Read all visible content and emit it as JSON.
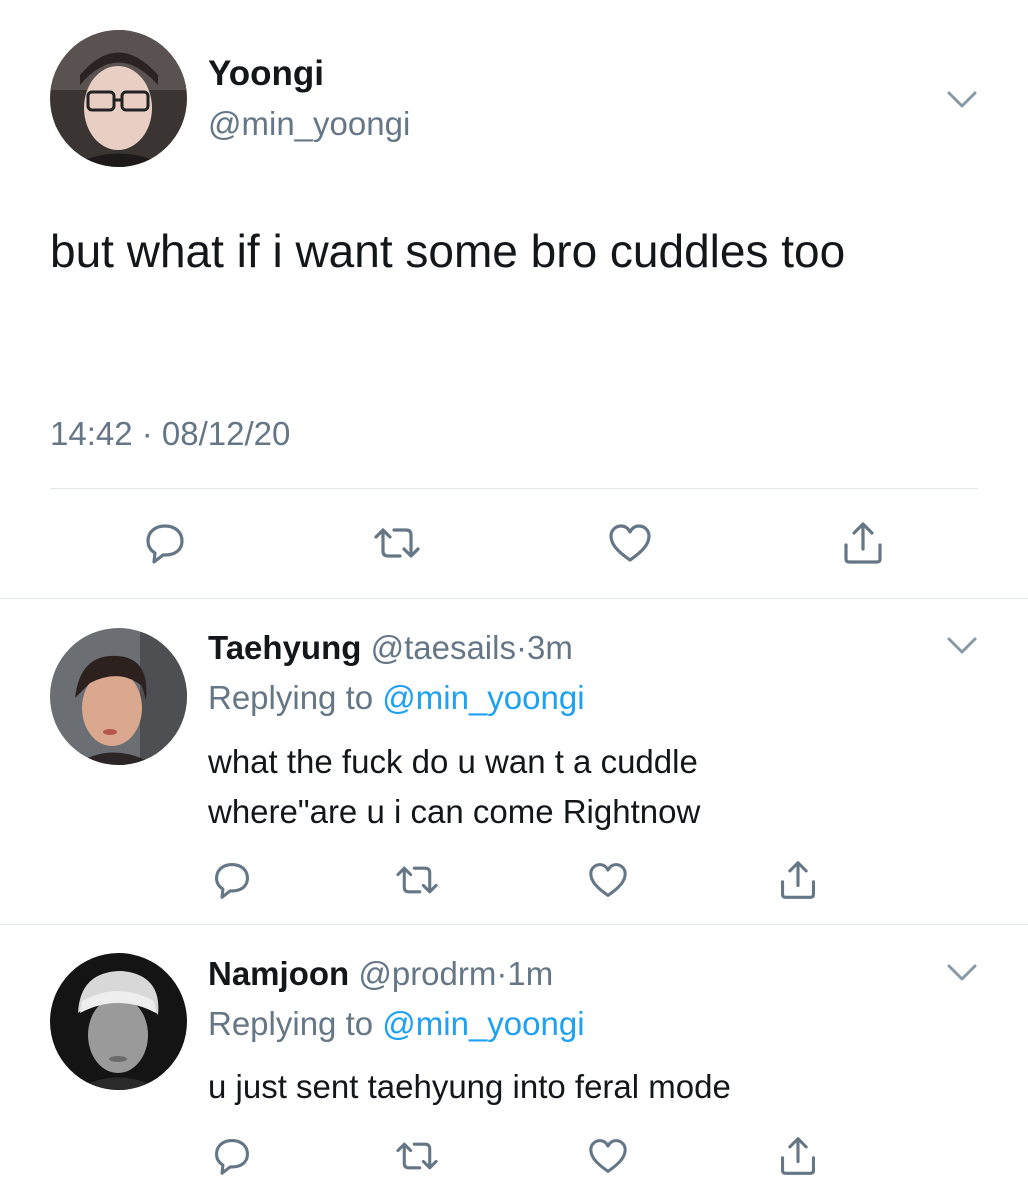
{
  "main_tweet": {
    "name": "Yoongi",
    "handle": "@min_yoongi",
    "text": "but what if i want some bro cuddles too",
    "timestamp": "14:42 · 08/12/20"
  },
  "replies": [
    {
      "name": "Taehyung",
      "handle": "@taesails",
      "separator": "·",
      "time": "3m",
      "replying_prefix": "Replying to",
      "replying_to": "@min_yoongi",
      "text_line1": "what the fuck do u wan t a cuddle",
      "text_line2": "where\"are u i can come Rightnow"
    },
    {
      "name": "Namjoon",
      "handle": "@prodrm",
      "separator": "·",
      "time": "1m",
      "replying_prefix": "Replying to",
      "replying_to": "@min_yoongi",
      "text_line1": "u just sent taehyung into feral mode"
    }
  ],
  "icons": {
    "reply": "reply-icon",
    "retweet": "retweet-icon",
    "like": "heart-icon",
    "share": "share-icon",
    "more": "chevron-down-icon"
  },
  "colors": {
    "text": "#14171a",
    "secondary": "#657786",
    "link": "#1da1f2",
    "divider": "#e1e8ed",
    "icon": "#657786"
  }
}
